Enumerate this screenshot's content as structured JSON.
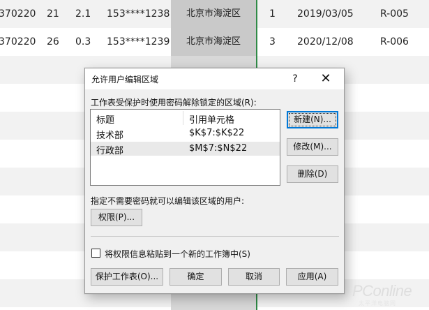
{
  "sheet": {
    "rows": [
      {
        "id": "370220",
        "age": "21",
        "score": "2.1",
        "phone": "153****1238",
        "district": "北京市海淀区",
        "level": "1",
        "date": "2019/03/05",
        "code": "R-005"
      },
      {
        "id": "370220",
        "age": "26",
        "score": "0.3",
        "phone": "153****1239",
        "district": "北京市海淀区",
        "level": "3",
        "date": "2020/12/08",
        "code": "R-006"
      }
    ]
  },
  "dialog": {
    "title": "允许用户编辑区域",
    "help": "?",
    "close": "✕",
    "unlock_label": "工作表受保护时使用密码解除锁定的区域(R):",
    "list": {
      "headers": [
        "标题",
        "引用单元格"
      ],
      "rows": [
        {
          "title": "技术部",
          "ref": "$K$7:$K$22"
        },
        {
          "title": "行政部",
          "ref": "$M$7:$N$22"
        }
      ]
    },
    "buttons": {
      "new": "新建(N)...",
      "modify": "修改(M)...",
      "delete": "删除(D)",
      "permissions": "权限(P)...",
      "protect_sheet": "保护工作表(O)...",
      "ok": "确定",
      "cancel": "取消",
      "apply": "应用(A)"
    },
    "users_label": "指定不需要密码就可以编辑该区域的用户:",
    "checkbox_label": "将权限信息粘贴到一个新的工作簿中(S)"
  },
  "watermark": {
    "main": "PConline",
    "sub": "太平洋电脑网"
  }
}
